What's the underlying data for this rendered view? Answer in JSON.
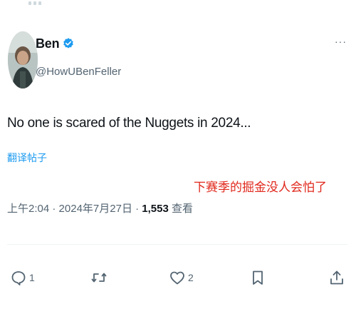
{
  "tweet": {
    "display_name": "Ben",
    "handle": "@HowUBenFeller",
    "text": "No one is scared of the Nuggets in 2024...",
    "translate_label": "翻译帖子",
    "time": "上午2:04",
    "separator": " · ",
    "date": "2024年7月27日",
    "views_count": "1,553",
    "views_label": " 查看"
  },
  "overlay": {
    "caption": "下赛季的掘金没人会怕了"
  },
  "actions": {
    "reply_count": "1",
    "like_count": "2"
  },
  "colors": {
    "accent": "#1d9bf0",
    "text_primary": "#0f1419",
    "text_secondary": "#536471",
    "caption_red": "#e0281c",
    "divider": "#eff3f4"
  },
  "icons": {
    "verified": "verified-badge-icon",
    "more": "more-dots-icon",
    "reply": "reply-bubble-icon",
    "retweet": "retweet-arrows-icon",
    "like": "heart-icon",
    "bookmark": "bookmark-icon",
    "share": "share-upload-icon"
  }
}
